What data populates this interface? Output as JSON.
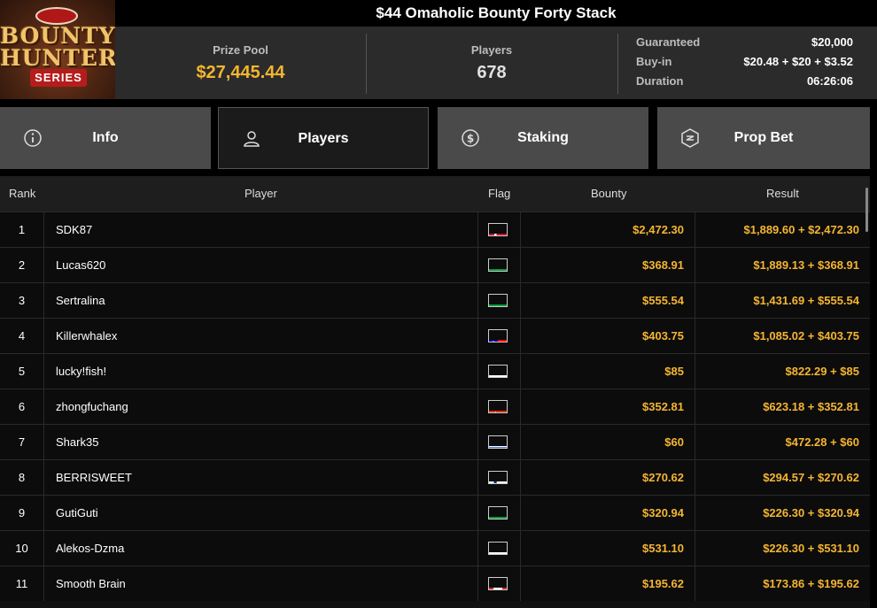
{
  "logo": {
    "line1": "BOUNTY",
    "line2": "HUNTERS",
    "line3": "SERIES"
  },
  "title": "$44 Omaholic Bounty Forty Stack",
  "stats": {
    "prize_pool_label": "Prize Pool",
    "prize_pool_value": "$27,445.44",
    "players_label": "Players",
    "players_value": "678",
    "guaranteed_label": "Guaranteed",
    "guaranteed_value": "$20,000",
    "buyin_label": "Buy-in",
    "buyin_value": "$20.48 + $20 + $3.52",
    "duration_label": "Duration",
    "duration_value": "06:26:06"
  },
  "tabs": [
    {
      "label": "Info",
      "icon": "info-icon",
      "active": false
    },
    {
      "label": "Players",
      "icon": "user-icon",
      "active": true
    },
    {
      "label": "Staking",
      "icon": "dollar-coin-icon",
      "active": false
    },
    {
      "label": "Prop Bet",
      "icon": "prop-bet-icon",
      "active": false
    }
  ],
  "table": {
    "headers": {
      "rank": "Rank",
      "player": "Player",
      "flag": "Flag",
      "bounty": "Bounty",
      "result": "Result"
    },
    "rows": [
      {
        "rank": "1",
        "player": "SDK87",
        "flag": "denmark",
        "bounty": "$2,472.30",
        "result": "$1,889.60 + $2,472.30"
      },
      {
        "rank": "2",
        "player": "Lucas620",
        "flag": "brazil",
        "bounty": "$368.91",
        "result": "$1,889.13 + $368.91"
      },
      {
        "rank": "3",
        "player": "Sertralina",
        "flag": "brazil",
        "bounty": "$555.54",
        "result": "$1,431.69 + $555.54"
      },
      {
        "rank": "4",
        "player": "Killerwhalex",
        "flag": "taiwan",
        "bounty": "$403.75",
        "result": "$1,085.02 + $403.75"
      },
      {
        "rank": "5",
        "player": "lucky!fish!",
        "flag": "poland",
        "bounty": "$85",
        "result": "$822.29 + $85"
      },
      {
        "rank": "6",
        "player": "zhongfuchang",
        "flag": "china",
        "bounty": "$352.81",
        "result": "$623.18 + $352.81"
      },
      {
        "rank": "7",
        "player": "Shark35",
        "flag": "israel",
        "bounty": "$60",
        "result": "$472.28 + $60"
      },
      {
        "rank": "8",
        "player": "BERRISWEET",
        "flag": "finland",
        "bounty": "$270.62",
        "result": "$294.57 + $270.62"
      },
      {
        "rank": "9",
        "player": "GutiGuti",
        "flag": "brazil",
        "bounty": "$320.94",
        "result": "$226.30 + $320.94"
      },
      {
        "rank": "10",
        "player": "Alekos-Dzma",
        "flag": "russia",
        "bounty": "$531.10",
        "result": "$226.30 + $531.10"
      },
      {
        "rank": "11",
        "player": "Smooth Brain",
        "flag": "canada",
        "bounty": "$195.62",
        "result": "$173.86 + $195.62"
      }
    ]
  },
  "colors": {
    "accent": "#f5b531",
    "tab_bg": "#4a4a4a",
    "header_bg": "#2b2b2b"
  }
}
